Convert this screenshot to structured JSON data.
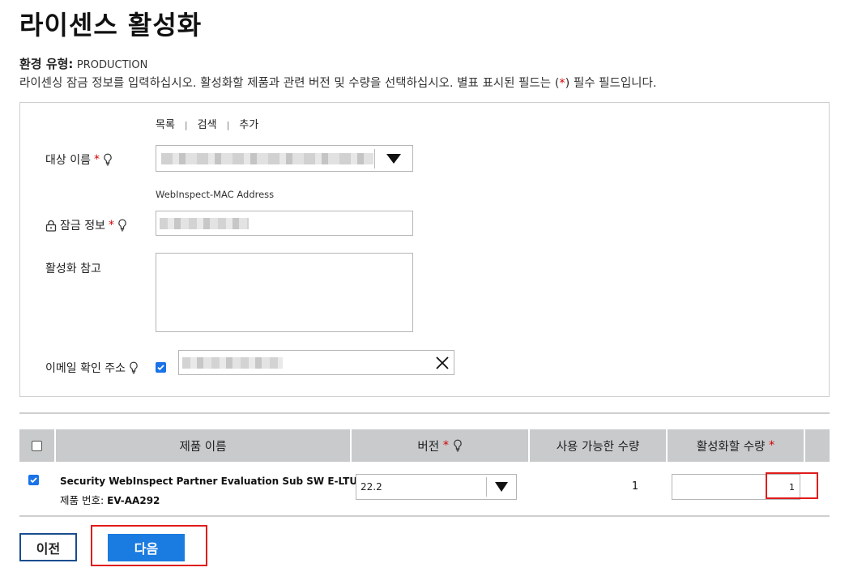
{
  "page": {
    "title": "라이센스 활성화",
    "env_label": "환경 유형:",
    "env_value": "PRODUCTION",
    "description_prefix": "라이센싱 잠금 정보를 입력하십시오. 활성화할 제품과 관련 버전 및 수량을 선택하십시오. 별표 표시된 필드는 (",
    "description_star": "*",
    "description_suffix": ") 필수 필드입니다."
  },
  "form": {
    "links": [
      "목록",
      "검색",
      "추가"
    ],
    "target_name": {
      "label": "대상 이름",
      "required": "*",
      "value": ""
    },
    "target_hint": "WebInspect-MAC Address",
    "lock_info": {
      "label": "잠금 정보",
      "required": "*",
      "value": ""
    },
    "activation_note": {
      "label": "활성화 참고",
      "value": ""
    },
    "email": {
      "label": "이메일 확인 주소",
      "checked": true,
      "value": ""
    }
  },
  "table": {
    "headers": {
      "product": "제품 이름",
      "version": "버전",
      "version_required": "*",
      "available": "사용 가능한 수량",
      "activate_qty": "활성화할 수량",
      "activate_required": "*"
    },
    "rows": [
      {
        "checked": true,
        "product_name": "Security WebInspect Partner Evaluation Sub SW E-LTU",
        "product_no_label": "제품 번호:",
        "product_no": "EV-AA292",
        "version": "22.2",
        "available": "1",
        "activate_qty": "1"
      }
    ]
  },
  "buttons": {
    "prev": "이전",
    "next": "다음"
  },
  "colors": {
    "accent": "#1a7be0",
    "required": "#d50000",
    "highlight": "#e01b1b",
    "header_bg": "#c8cacc"
  }
}
